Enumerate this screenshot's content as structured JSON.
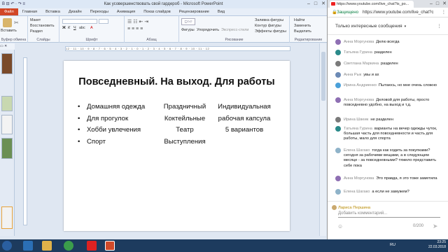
{
  "powerpoint": {
    "qat": "В ⊟ ↶ · ↷ ≡",
    "window_title": "Как усовершенствовать свой гардероб - Microsoft PowerPoint",
    "tabs": [
      "Файл",
      "Главная",
      "Вставка",
      "Дизайн",
      "Переходы",
      "Анимация",
      "Показ слайдов",
      "Рецензирование",
      "Вид"
    ],
    "ribbon": {
      "clipboard": {
        "paste": "Вставить",
        "cut": "Вырезать",
        "label": "Буфер обмена"
      },
      "slides": {
        "layout": "Макет",
        "reset": "Восстановить",
        "section": "Раздел",
        "label": "Слайды"
      },
      "font": {
        "label": "Шрифт"
      },
      "paragraph": {
        "label": "Абзац"
      },
      "drawing": {
        "shapes": "Фигуры",
        "arrange": "Упорядочить",
        "quick_styles": "Экспресс-стили",
        "fill": "Заливка фигуры",
        "outline": "Контур фигуры",
        "effects": "Эффекты фигуры",
        "label": "Рисование"
      },
      "editing": {
        "find": "Найти",
        "replace": "Заменить",
        "select": "Выделить",
        "label": "Редактирование"
      }
    },
    "slide": {
      "title": "Повседневный. На выход. Для работы",
      "col1": [
        "Домашняя одежда",
        "Для прогулок",
        "Хобби увлечения",
        "Спорт"
      ],
      "col2": [
        "Праздничный",
        "Коктейльные",
        "Театр",
        "Выступления"
      ],
      "col3": [
        "Индивидуальная",
        "рабочая капсула",
        "5 вариантов"
      ]
    },
    "ruler_text": "12 · 11 · 10 · 9 · 8 · 7 · 6 · 5 · 4 · 3 · 2 · 1 · 0 · 1 · 2 · 3 · 4 · 5 · 6 · 7 · 8 · 9 · 10 · 11 · 12"
  },
  "browser": {
    "tab_title": "https://www.youtube.com/live_chat?is_po...",
    "secure_label": "Защищено",
    "url": "https://www.youtube.com/live_chat?c",
    "chat_mode": "Только интересные сообщения",
    "messages": [
      {
        "name": "Анна Моргунова",
        "text": "Делю всегда",
        "color": "#8e6fb3"
      },
      {
        "name": "Татьяна Гурина",
        "text": "разделен",
        "color": "#2b8a8a"
      },
      {
        "name": "Светлана Маркина",
        "text": "разделен",
        "color": "#7a7a7a"
      },
      {
        "name": "Анна Рык",
        "text": "увы и ах",
        "color": "#6c8ab5"
      },
      {
        "name": "Ирина Андриенко",
        "text": "Пытаюсь, но мне очень сложно",
        "color": "#4aa0d9"
      },
      {
        "name": "Анна Моргунова",
        "text": "Деловой для работы, просто повседневно удобно, на выход и т.д.",
        "color": "#8e6fb3"
      },
      {
        "name": "Ирина Швеик",
        "text": "не разделен",
        "color": "#7a7a7a"
      },
      {
        "name": "Татьяна Гурина",
        "text": "варианты на вечер одежды чуток, большая часть для повседневности и часть для работы, мало для спорта",
        "color": "#2b8a8a"
      },
      {
        "name": "Елена Шагако",
        "text": "тогда как ходить за покупками? сегодня за рабочими вещами, а в следующем месяце - за повседневными? тяжело представить себе пока",
        "color": "#8fb3c9"
      },
      {
        "name": "Анна Моргунова",
        "text": "Это правда, я это тоже заметила",
        "color": "#8e6fb3"
      },
      {
        "name": "Елена Шагако",
        "text": "а если не замужем?",
        "color": "#8fb3c9"
      }
    ],
    "current_user": "Лариса Першина",
    "input_placeholder": "Добавить комментарий...",
    "char_count": "0/200"
  },
  "taskbar": {
    "lang": "RU",
    "time": "23:25",
    "date": "22.03.2018"
  }
}
